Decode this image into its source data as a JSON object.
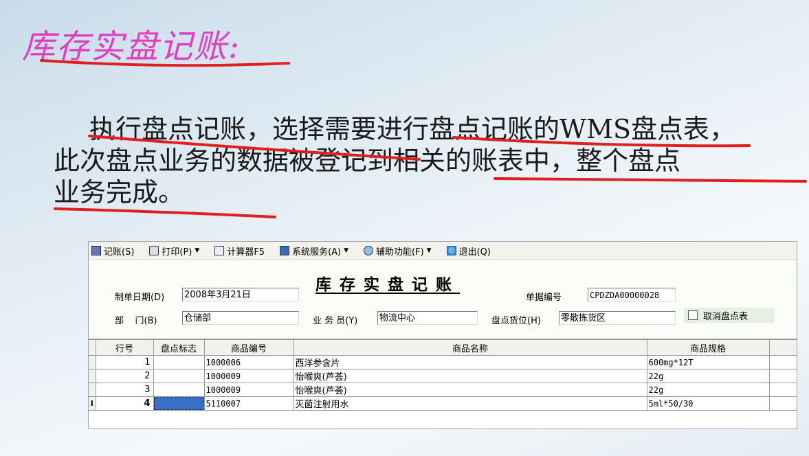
{
  "slide": {
    "title": "库存实盘记账:",
    "paragraph_lines": [
      "执行盘点记账，选择需要进行盘点记账的WMS盘点表，",
      "此次盘点业务的数据被登记到相关的账表中，整个盘点",
      "业务完成。"
    ],
    "accent_color": "#e040c0",
    "annotation_color": "#e02020"
  },
  "toolbar": {
    "items": [
      {
        "label": "记账(S)",
        "icon": "save-icon"
      },
      {
        "label": "打印(P)",
        "icon": "print-icon",
        "has_dropdown": true
      },
      {
        "label": "计算器F5",
        "icon": "calculator-icon"
      },
      {
        "label": "系统服务(A)",
        "icon": "system-icon",
        "has_dropdown": true
      },
      {
        "label": "辅助功能(F)",
        "icon": "help-icon",
        "has_dropdown": true
      },
      {
        "label": "退出(Q)",
        "icon": "exit-icon"
      }
    ]
  },
  "form": {
    "title": "库存实盘记账",
    "date_label": "制单日期(D)",
    "date_value": "2008年3月21日",
    "doc_no_label": "单据编号",
    "doc_no_value": "CPDZDA00000028",
    "dept_label": "部    门(B)",
    "dept_value": "仓储部",
    "staff_label": "业 务 员(Y)",
    "staff_value": "物流中心",
    "location_label": "盘点货位(H)",
    "location_value": "零散拣货区",
    "cancel_label": "取消盘点表"
  },
  "grid": {
    "columns": [
      "行号",
      "盘点标志",
      "商品编号",
      "商品名称",
      "商品规格"
    ],
    "rows": [
      {
        "row_no": "1",
        "flag": "",
        "code": "1000006",
        "name": "西洋参含片",
        "spec": "600mg*12T",
        "current": false
      },
      {
        "row_no": "2",
        "flag": "",
        "code": "1000009",
        "name": "怡喉爽(芦荟)",
        "spec": "22g",
        "current": false
      },
      {
        "row_no": "3",
        "flag": "",
        "code": "1000009",
        "name": "怡喉爽(芦荟)",
        "spec": "22g",
        "current": false
      },
      {
        "row_no": "4",
        "flag": "",
        "code": "5110007",
        "name": "灭菌注射用水",
        "spec": "5ml*50/30",
        "current": true
      }
    ],
    "current_row_indicator": "I"
  }
}
